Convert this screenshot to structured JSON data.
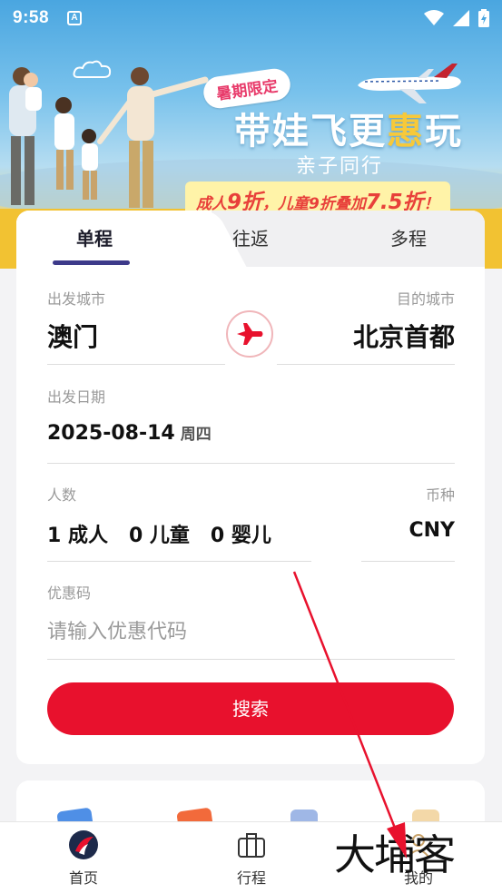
{
  "status_bar": {
    "time": "9:58",
    "notif_label": "A"
  },
  "banner": {
    "tag": "暑期限定",
    "slogan_a": "带娃飞更",
    "slogan_hl": "惠",
    "slogan_b": "玩",
    "sub_slogan": "亲子同行",
    "promo_a": "成人",
    "promo_b": "9折",
    "promo_c": "，儿童9折叠加",
    "promo_d": "7.5折",
    "promo_e": "！"
  },
  "tabs": {
    "one_way": "单程",
    "round_trip": "往返",
    "multi_city": "多程"
  },
  "form": {
    "depart_city_label": "出发城市",
    "depart_city": "澳门",
    "dest_city_label": "目的城市",
    "dest_city": "北京首都",
    "date_label": "出发日期",
    "date": "2025-08-14",
    "weekday": "周四",
    "pax_label": "人数",
    "pax": "1 成人   0 儿童   0 婴儿",
    "currency_label": "币种",
    "currency": "CNY",
    "promo_label": "优惠码",
    "promo_placeholder": "请输入优惠代码",
    "search": "搜索"
  },
  "tabbar": {
    "home": "首页",
    "trips": "行程",
    "mine": "我的"
  },
  "watermark": "大埔客",
  "colors": {
    "brand_red": "#e8112d",
    "tab_underline": "#3d3a8a"
  }
}
